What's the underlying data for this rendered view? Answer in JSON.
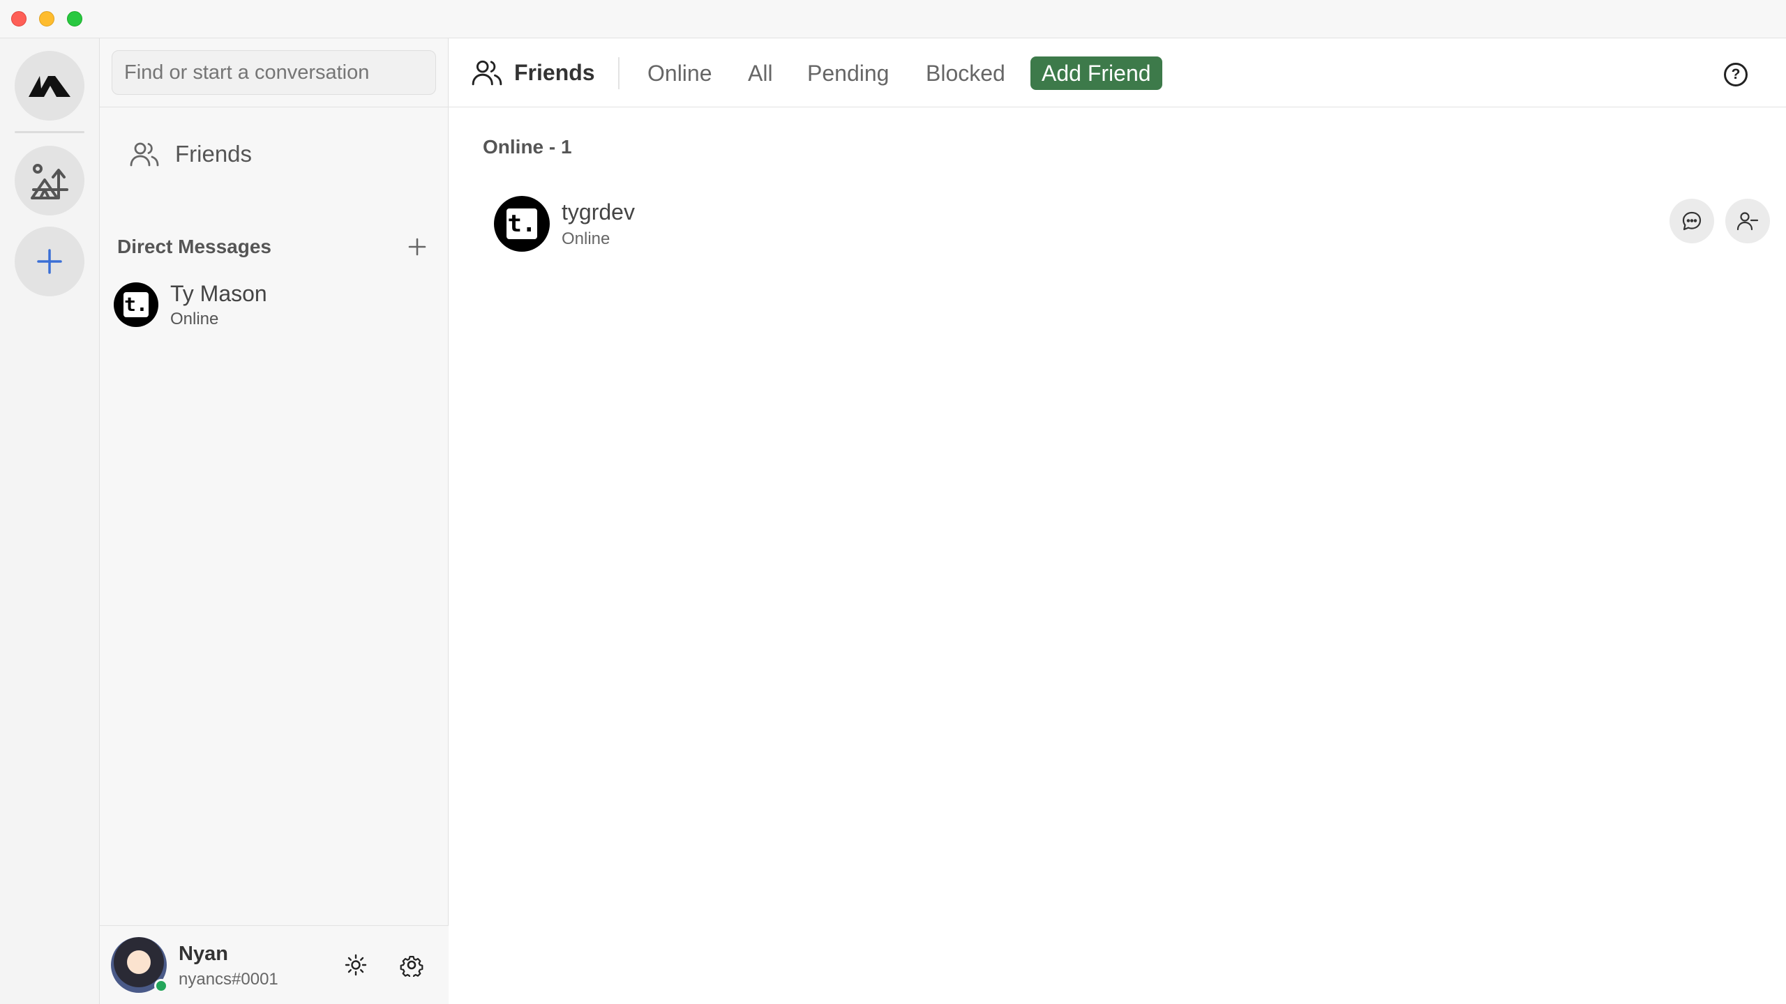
{
  "window": {
    "controls": [
      "close",
      "minimize",
      "maximize"
    ]
  },
  "rail": {
    "items": [
      {
        "name": "home",
        "icon": "app-logo-icon"
      },
      {
        "name": "server",
        "icon": "campsite-icon"
      },
      {
        "name": "add-server",
        "icon": "plus-icon"
      }
    ]
  },
  "sidebar": {
    "search": {
      "placeholder": "Find or start a conversation",
      "value": ""
    },
    "friends_label": "Friends",
    "dm_header": "Direct Messages",
    "dms": [
      {
        "name": "Ty Mason",
        "status": "Online",
        "avatar_letter": "t."
      }
    ],
    "user": {
      "name": "Nyan",
      "tag": "nyancs#0001",
      "presence_color": "#23a55a"
    }
  },
  "topbar": {
    "title": "Friends",
    "tabs": [
      {
        "label": "Online"
      },
      {
        "label": "All"
      },
      {
        "label": "Pending"
      },
      {
        "label": "Blocked"
      }
    ],
    "add_friend_label": "Add Friend",
    "add_friend_color": "#3d7a4a",
    "help_glyph": "?"
  },
  "main": {
    "section_title": "Online - 1",
    "friends": [
      {
        "name": "tygrdev",
        "status": "Online",
        "avatar_letter": "t."
      }
    ]
  }
}
